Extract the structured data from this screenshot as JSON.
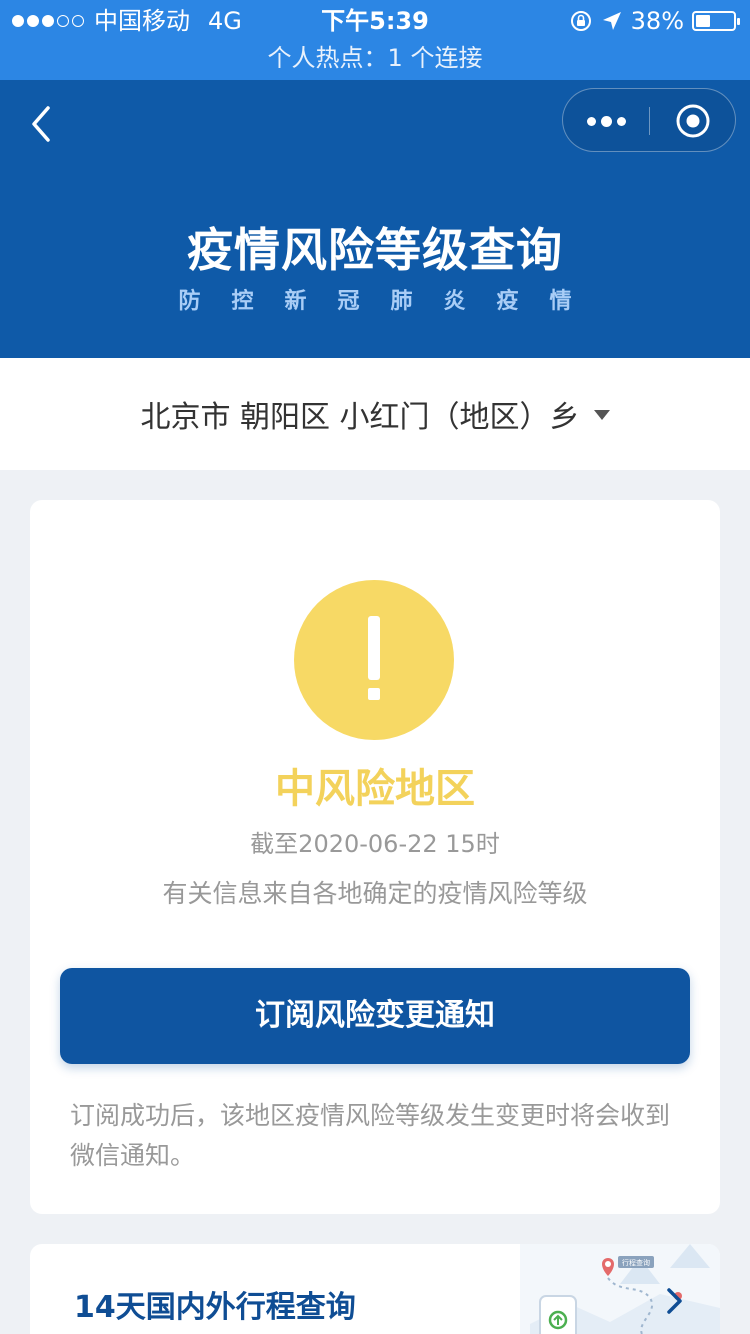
{
  "status_bar": {
    "carrier": "中国移动",
    "network": "4G",
    "time": "下午5:39",
    "battery": "38%",
    "battery_level": 0.38,
    "hotspot": "个人热点：1 个连接"
  },
  "header": {
    "title": "疫情风险等级查询",
    "subtitle": "防控新冠肺炎疫情"
  },
  "location": {
    "value": "北京市 朝阳区 小红门（地区）乡"
  },
  "risk_card": {
    "level": "中风险地区",
    "as_of": "截至2020-06-22 15时",
    "source_note": "有关信息来自各地确定的疫情风险等级",
    "subscribe_button": "订阅风险变更通知",
    "subscribe_note": "订阅成功后，该地区疫情风险等级发生变更时将会收到微信通知。",
    "level_color": "#f3d25b"
  },
  "travel_card": {
    "title": "14天国内外行程查询",
    "map_label": "行程查询"
  },
  "colors": {
    "status_bar": "#2c86e4",
    "header": "#0f5aa8",
    "button": "#0f55a1",
    "warning": "#f7d965"
  }
}
